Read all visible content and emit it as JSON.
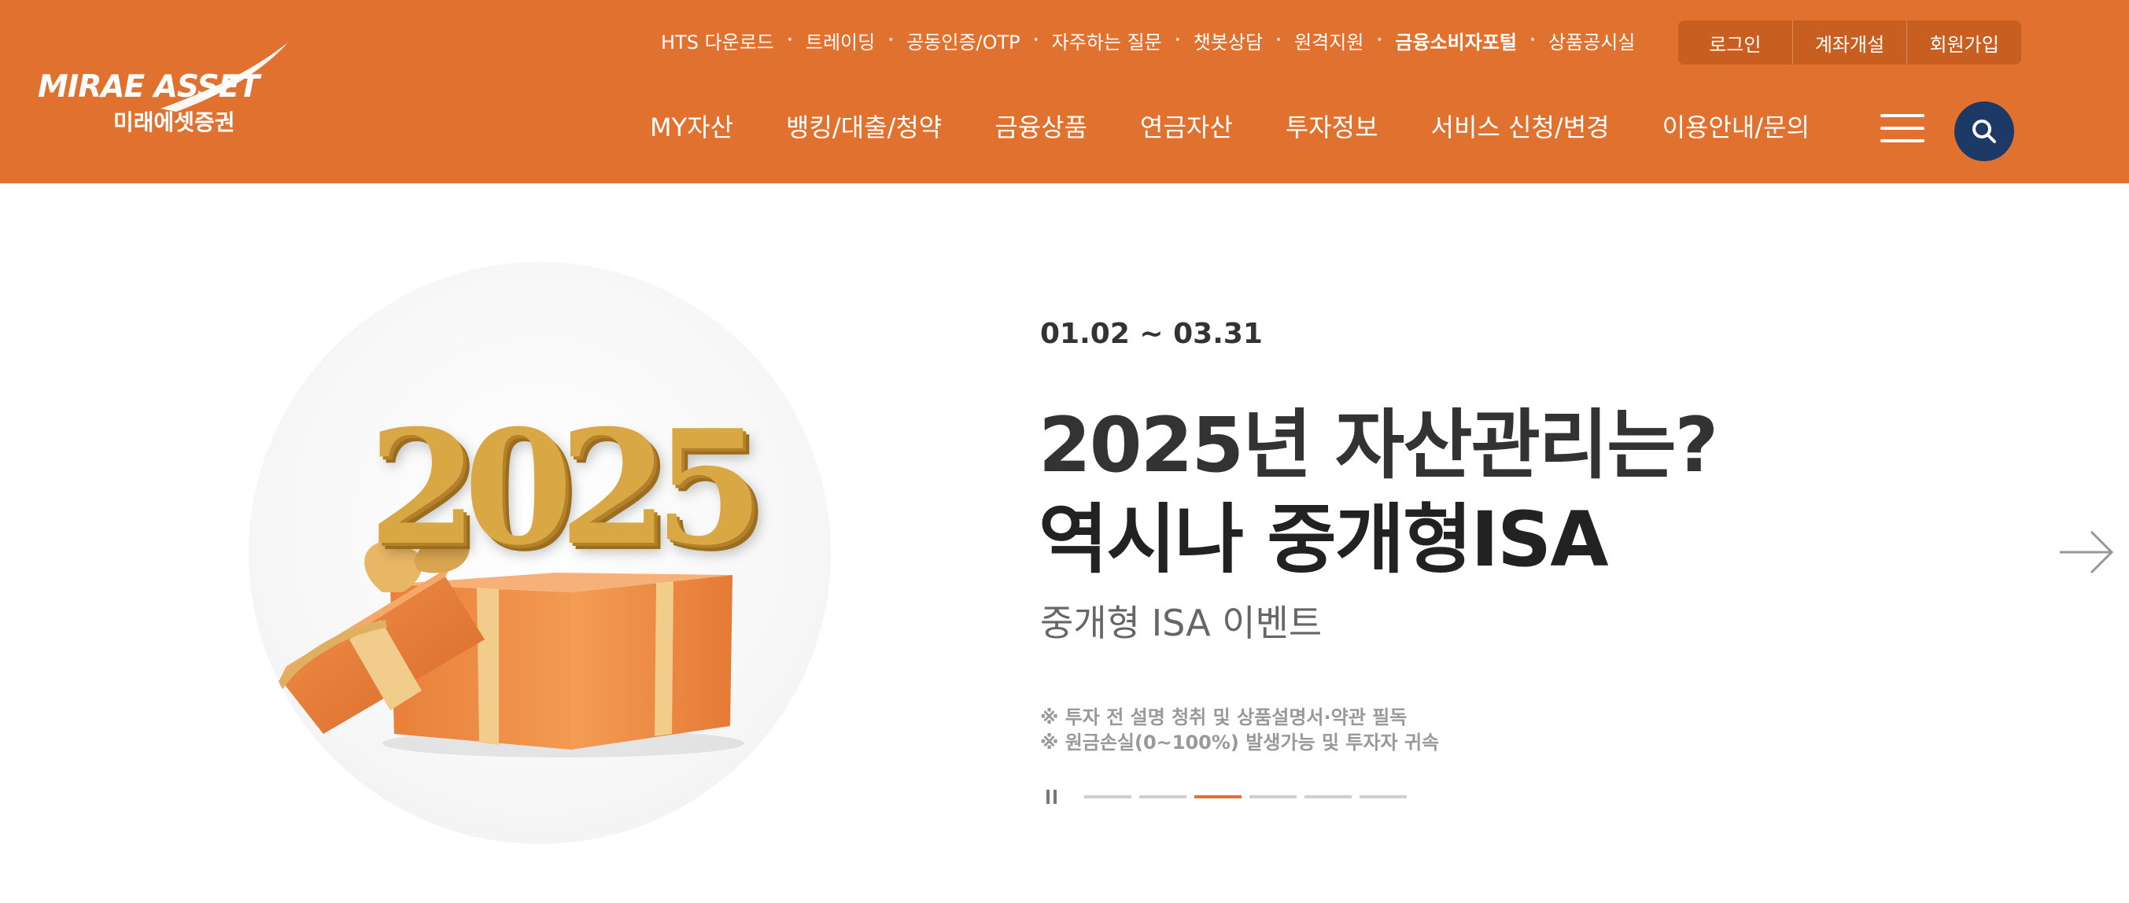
{
  "brand": {
    "name_en": "MIRAE ASSET",
    "name_ko": "미래에셋증권",
    "color": "#e1712f",
    "search_color": "#1d3a66"
  },
  "utility_nav": [
    {
      "label": "HTS 다운로드",
      "bold": false
    },
    {
      "label": "트레이딩",
      "bold": false
    },
    {
      "label": "공동인증/OTP",
      "bold": false
    },
    {
      "label": "자주하는 질문",
      "bold": false
    },
    {
      "label": "챗봇상담",
      "bold": false
    },
    {
      "label": "원격지원",
      "bold": false
    },
    {
      "label": "금융소비자포털",
      "bold": true
    },
    {
      "label": "상품공시실",
      "bold": false
    }
  ],
  "auth": {
    "login": "로그인",
    "open_account": "계좌개설",
    "signup": "회원가입"
  },
  "main_nav": [
    "MY자산",
    "뱅킹/대출/청약",
    "금융상품",
    "연금자산",
    "투자정보",
    "서비스 신청/변경",
    "이용안내/문의"
  ],
  "icons": {
    "menu": "hamburger-menu-icon",
    "search": "search-icon",
    "next": "arrow-right-icon",
    "pause": "pause-icon"
  },
  "hero": {
    "image_text": "2025",
    "period": "01.02 ~ 03.31",
    "title_line1": "2025년 자산관리는?",
    "title_line2": "역시나 중개형ISA",
    "subtitle": "중개형 ISA 이벤트",
    "notice_1": "※ 투자 전 설명 청취 및 상품설명서·약관 필독",
    "notice_2": "※ 원금손실(0~100%) 발생가능 및 투자자 귀속"
  },
  "slider": {
    "total": 6,
    "active_index": 2
  }
}
